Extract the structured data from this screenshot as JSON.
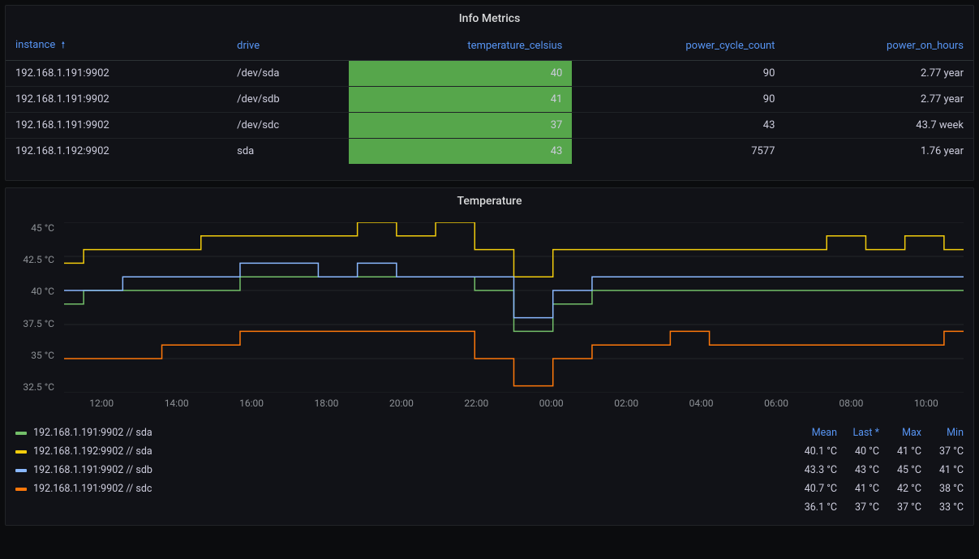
{
  "info_panel": {
    "title": "Info Metrics",
    "columns": {
      "instance": "instance",
      "drive": "drive",
      "temperature": "temperature_celsius",
      "power_cycle": "power_cycle_count",
      "power_on": "power_on_hours"
    },
    "rows": [
      {
        "instance": "192.168.1.191:9902",
        "drive": "/dev/sda",
        "temp": "40",
        "pcc": "90",
        "poh": "2.77 year"
      },
      {
        "instance": "192.168.1.191:9902",
        "drive": "/dev/sdb",
        "temp": "41",
        "pcc": "90",
        "poh": "2.77 year"
      },
      {
        "instance": "192.168.1.191:9902",
        "drive": "/dev/sdc",
        "temp": "37",
        "pcc": "43",
        "poh": "43.7 week"
      },
      {
        "instance": "192.168.1.192:9902",
        "drive": "sda",
        "temp": "43",
        "pcc": "7577",
        "poh": "1.76 year"
      }
    ]
  },
  "temp_panel": {
    "title": "Temperature",
    "y_ticks": [
      "45 °C",
      "42.5 °C",
      "40 °C",
      "37.5 °C",
      "35 °C",
      "32.5 °C"
    ],
    "x_ticks": [
      "12:00",
      "14:00",
      "16:00",
      "18:00",
      "20:00",
      "22:00",
      "00:00",
      "02:00",
      "04:00",
      "06:00",
      "08:00",
      "10:00"
    ],
    "stats_headers": {
      "mean": "Mean",
      "last": "Last *",
      "max": "Max",
      "min": "Min"
    },
    "series": [
      {
        "name": "192.168.1.191:9902 // sda",
        "color": "#73bf69",
        "mean": "40.1 °C",
        "last": "40 °C",
        "max": "41 °C",
        "min": "37 °C"
      },
      {
        "name": "192.168.1.192:9902 // sda",
        "color": "#f2cc0c",
        "mean": "43.3 °C",
        "last": "43 °C",
        "max": "45 °C",
        "min": "41 °C"
      },
      {
        "name": "192.168.1.191:9902 // sdb",
        "color": "#8ab8ff",
        "mean": "40.7 °C",
        "last": "41 °C",
        "max": "42 °C",
        "min": "38 °C"
      },
      {
        "name": "192.168.1.191:9902 // sdc",
        "color": "#ff780a",
        "mean": "36.1 °C",
        "last": "37 °C",
        "max": "37 °C",
        "min": "33 °C"
      }
    ]
  },
  "chart_data": {
    "type": "line",
    "title": "Temperature",
    "ylabel": "°C",
    "ylim": [
      32.5,
      45
    ],
    "x": [
      "12:00",
      "13:00",
      "14:00",
      "15:00",
      "16:00",
      "17:00",
      "18:00",
      "19:00",
      "20:00",
      "21:00",
      "22:00",
      "23:00",
      "00:00",
      "01:00",
      "02:00",
      "03:00",
      "04:00",
      "05:00",
      "06:00",
      "07:00",
      "08:00",
      "09:00",
      "10:00",
      "11:00"
    ],
    "series": [
      {
        "name": "192.168.1.191:9902 // sda",
        "color": "#73bf69",
        "values": [
          39,
          40,
          40,
          40,
          40,
          41,
          41,
          41,
          41,
          41,
          41,
          40,
          37,
          39,
          40,
          40,
          40,
          40,
          40,
          40,
          40,
          40,
          40,
          40
        ]
      },
      {
        "name": "192.168.1.192:9902 // sda",
        "color": "#f2cc0c",
        "values": [
          42,
          43,
          43,
          43,
          44,
          44,
          44,
          44,
          45,
          44,
          45,
          43,
          41,
          43,
          43,
          43,
          43,
          43,
          43,
          43,
          44,
          43,
          44,
          43
        ]
      },
      {
        "name": "192.168.1.191:9902 // sdb",
        "color": "#8ab8ff",
        "values": [
          40,
          40,
          41,
          41,
          41,
          42,
          42,
          41,
          42,
          41,
          41,
          41,
          38,
          40,
          41,
          41,
          41,
          41,
          41,
          41,
          41,
          41,
          41,
          41
        ]
      },
      {
        "name": "192.168.1.191:9902 // sdc",
        "color": "#ff780a",
        "values": [
          35,
          35,
          35,
          36,
          36,
          37,
          37,
          37,
          37,
          37,
          37,
          35,
          33,
          35,
          36,
          36,
          37,
          36,
          36,
          36,
          36,
          36,
          36,
          37
        ]
      }
    ]
  }
}
